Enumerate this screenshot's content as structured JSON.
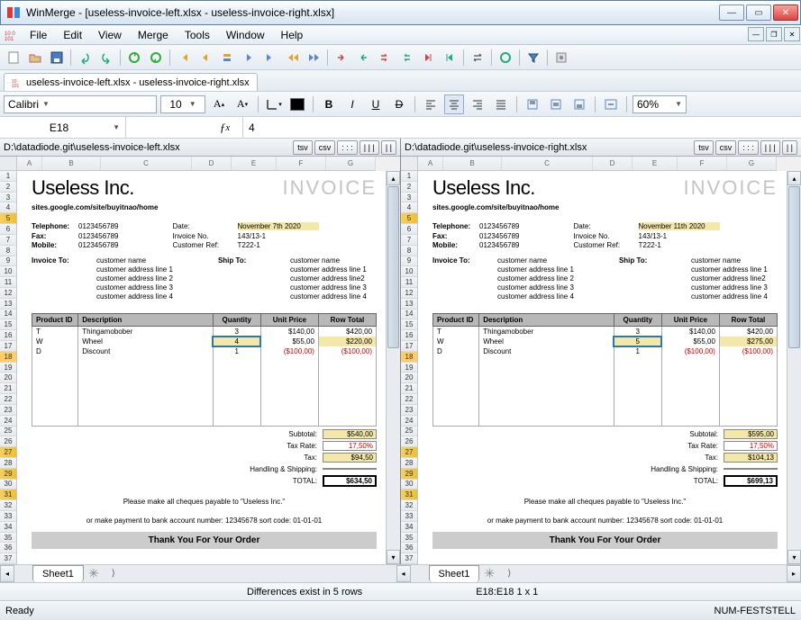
{
  "window": {
    "title": "WinMerge - [useless-invoice-left.xlsx - useless-invoice-right.xlsx]"
  },
  "menu": [
    "File",
    "Edit",
    "View",
    "Merge",
    "Tools",
    "Window",
    "Help"
  ],
  "doc_tab": "useless-invoice-left.xlsx - useless-invoice-right.xlsx",
  "font": {
    "name": "Calibri",
    "size": "10"
  },
  "zoom": "60%",
  "cell_ref": "E18",
  "formula": "4",
  "view_buttons": [
    "tsv",
    "csv",
    ": : :",
    "| | |",
    "| |"
  ],
  "panes": {
    "left": {
      "path": "D:\\datadiode.git\\useless-invoice-left.xlsx",
      "company": "Useless Inc.",
      "invoice_word": "INVOICE",
      "site": "sites.google.com/site/buyitnao/home",
      "contacts": [
        {
          "k": "Telephone:",
          "v": "0123456789"
        },
        {
          "k": "Fax:",
          "v": "0123456789"
        },
        {
          "k": "Mobile:",
          "v": "0123456789"
        }
      ],
      "meta": [
        {
          "k": "Date:",
          "v": "November 7th 2020",
          "hl": true
        },
        {
          "k": "Invoice No.",
          "v": "143/13-1"
        },
        {
          "k": "Customer Ref:",
          "v": "T222-1"
        }
      ],
      "bill_label": "Invoice To:",
      "bill_lines": [
        "customer name",
        "customer address line 1",
        "customer address line 2",
        "customer address line 3",
        "customer address line 4"
      ],
      "ship_label": "Ship To:",
      "ship_lines": [
        "customer name",
        "customer address line 1",
        "customer address line2",
        "customer address line 3",
        "customer address line 4"
      ],
      "th": [
        "Product ID",
        "Description",
        "Quantity",
        "Unit Price",
        "Row Total"
      ],
      "rows": [
        {
          "id": "T",
          "desc": "Thingamobober",
          "qty": "3",
          "price": "$140,00",
          "tot": "$420,00"
        },
        {
          "id": "W",
          "desc": "Wheel",
          "qty": "4",
          "price": "$55,00",
          "tot": "$220,00",
          "hl": true,
          "cursor": true
        },
        {
          "id": "D",
          "desc": "Discount",
          "qty": "1",
          "price": "($100,00)",
          "tot": "($100,00)",
          "neg": true
        }
      ],
      "totals": [
        {
          "k": "Subtotal:",
          "v": "$540,00",
          "hl": true
        },
        {
          "k": "Tax Rate:",
          "v": "17,50%",
          "red": true
        },
        {
          "k": "Tax:",
          "v": "$94,50",
          "hl": true
        },
        {
          "k": "Handling & Shipping:",
          "v": ""
        },
        {
          "k": "TOTAL:",
          "v": "$634,50",
          "final": true
        }
      ],
      "foot1": "Please make all cheques payable to \"Useless Inc.\"",
      "foot2": "or make payment to bank account number: 12345678 sort code: 01-01-01",
      "thanks": "Thank You For Your Order"
    },
    "right": {
      "path": "D:\\datadiode.git\\useless-invoice-right.xlsx",
      "company": "Useless Inc.",
      "invoice_word": "INVOICE",
      "site": "sites.google.com/site/buyitnao/home",
      "contacts": [
        {
          "k": "Telephone:",
          "v": "0123456789"
        },
        {
          "k": "Fax:",
          "v": "0123456789"
        },
        {
          "k": "Mobile:",
          "v": "0123456789"
        }
      ],
      "meta": [
        {
          "k": "Date:",
          "v": "November 11th 2020",
          "hl": true
        },
        {
          "k": "Invoice No.",
          "v": "143/13-1"
        },
        {
          "k": "Customer Ref:",
          "v": "T222-1"
        }
      ],
      "bill_label": "Invoice To:",
      "bill_lines": [
        "customer name",
        "customer address line 1",
        "customer address line 2",
        "customer address line 3",
        "customer address line 4"
      ],
      "ship_label": "Ship To:",
      "ship_lines": [
        "customer name",
        "customer address line 1",
        "customer address line2",
        "customer address line 3",
        "customer address line 4"
      ],
      "th": [
        "Product ID",
        "Description",
        "Quantity",
        "Unit Price",
        "Row Total"
      ],
      "rows": [
        {
          "id": "T",
          "desc": "Thingamobober",
          "qty": "3",
          "price": "$140,00",
          "tot": "$420,00"
        },
        {
          "id": "W",
          "desc": "Wheel",
          "qty": "5",
          "price": "$55,00",
          "tot": "$275,00",
          "hl": true,
          "cursor": true
        },
        {
          "id": "D",
          "desc": "Discount",
          "qty": "1",
          "price": "($100,00)",
          "tot": "($100,00)",
          "neg": true
        }
      ],
      "totals": [
        {
          "k": "Subtotal:",
          "v": "$595,00",
          "hl": true
        },
        {
          "k": "Tax Rate:",
          "v": "17,50%",
          "red": true
        },
        {
          "k": "Tax:",
          "v": "$104,13",
          "hl": true
        },
        {
          "k": "Handling & Shipping:",
          "v": ""
        },
        {
          "k": "TOTAL:",
          "v": "$699,13",
          "final": true
        }
      ],
      "foot1": "Please make all cheques payable to \"Useless Inc.\"",
      "foot2": "or make payment to bank account number: 12345678 sort code: 01-01-01",
      "thanks": "Thank You For Your Order"
    }
  },
  "diff_rows": [
    5,
    18,
    27,
    29,
    31
  ],
  "sheet_tab": "Sheet1",
  "info_center": "Differences exist in 5 rows",
  "info_right": "E18:E18 1 x 1",
  "status_left": "Ready",
  "status_right": "NUM-FESTSTELL"
}
